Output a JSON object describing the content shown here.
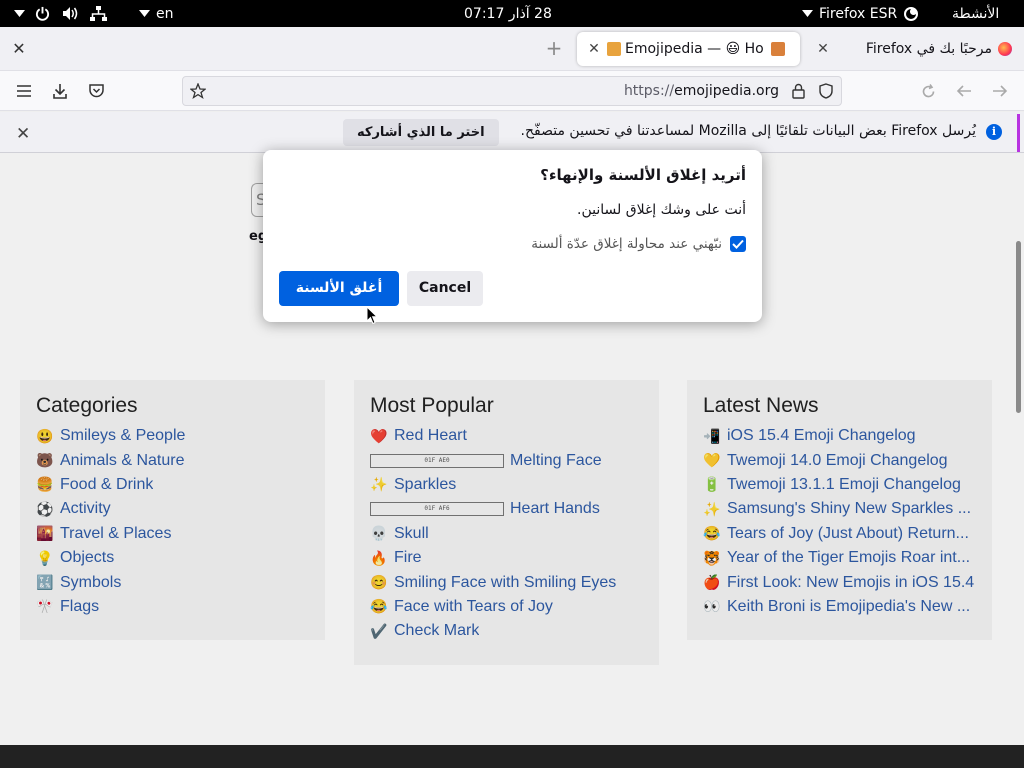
{
  "topbar": {
    "activities": "الأنشطة",
    "app_name": "Firefox ESR",
    "clock": "28 آذار  07:17",
    "language": "en"
  },
  "tabs": [
    {
      "label": "مرحبًا بك في Firefox",
      "state": "inactive"
    },
    {
      "label": "Emojipedia — 😃 Home",
      "state": "active"
    }
  ],
  "navbar": {
    "url_prefix": "https://",
    "url_domain": "emojipedia.org"
  },
  "notification": {
    "text": "يُرسل Firefox بعض البيانات تلقائيًا إلى Mozilla لمساعدتنا في تحسين متصفّح.",
    "button": "اختر ما الذي أشاركه"
  },
  "page": {
    "search_stub": "S",
    "search_hint": "eg",
    "categories": {
      "title": "Categories",
      "items": [
        {
          "emoji": "😃",
          "label": "Smileys & People"
        },
        {
          "emoji": "🐻",
          "label": "Animals & Nature"
        },
        {
          "emoji": "🍔",
          "label": "Food & Drink"
        },
        {
          "emoji": "⚽",
          "label": "Activity"
        },
        {
          "emoji": "🌇",
          "label": "Travel & Places"
        },
        {
          "emoji": "💡",
          "label": "Objects"
        },
        {
          "emoji": "🔣",
          "label": "Symbols"
        },
        {
          "emoji": "🎌",
          "label": "Flags"
        }
      ]
    },
    "popular": {
      "title": "Most Popular",
      "items": [
        {
          "emoji": "❤️",
          "label": "Red Heart"
        },
        {
          "emoji": "",
          "missing": "01F AE0",
          "label": "Melting Face"
        },
        {
          "emoji": "✨",
          "label": "Sparkles"
        },
        {
          "emoji": "",
          "missing": "01F AF6",
          "label": "Heart Hands"
        },
        {
          "emoji": "💀",
          "label": "Skull"
        },
        {
          "emoji": "🔥",
          "label": "Fire"
        },
        {
          "emoji": "😊",
          "label": "Smiling Face with Smiling Eyes"
        },
        {
          "emoji": "😂",
          "label": "Face with Tears of Joy"
        },
        {
          "emoji": "✔️",
          "label": "Check Mark"
        }
      ]
    },
    "news": {
      "title": "Latest News",
      "items": [
        {
          "emoji": "📲",
          "label": "iOS 15.4 Emoji Changelog"
        },
        {
          "emoji": "💛",
          "label": "Twemoji 14.0 Emoji Changelog"
        },
        {
          "emoji": "🔋",
          "label": "Twemoji 13.1.1 Emoji Changelog"
        },
        {
          "emoji": "✨",
          "label": "Samsung's Shiny New Sparkles ..."
        },
        {
          "emoji": "😂",
          "label": "Tears of Joy (Just About) Return..."
        },
        {
          "emoji": "🐯",
          "label": "Year of the Tiger Emojis Roar int..."
        },
        {
          "emoji": "🍎",
          "label": "First Look: New Emojis in iOS 15.4"
        },
        {
          "emoji": "👀",
          "label": "Keith Broni is Emojipedia's New ..."
        }
      ]
    }
  },
  "dialog": {
    "title": "أتريد إغلاق الألسنة والإنهاء؟",
    "message": "أنت على وشك إغلاق لسانين.",
    "checkbox_label": "نبّهني عند محاولة إغلاق عدّة ألسنة",
    "checkbox_checked": true,
    "confirm_label": "أغلق الألسنة",
    "cancel_label": "Cancel"
  },
  "colors": {
    "accent": "#0061e0",
    "link": "#2f5ca8",
    "notif_accent": "#b833e1"
  }
}
